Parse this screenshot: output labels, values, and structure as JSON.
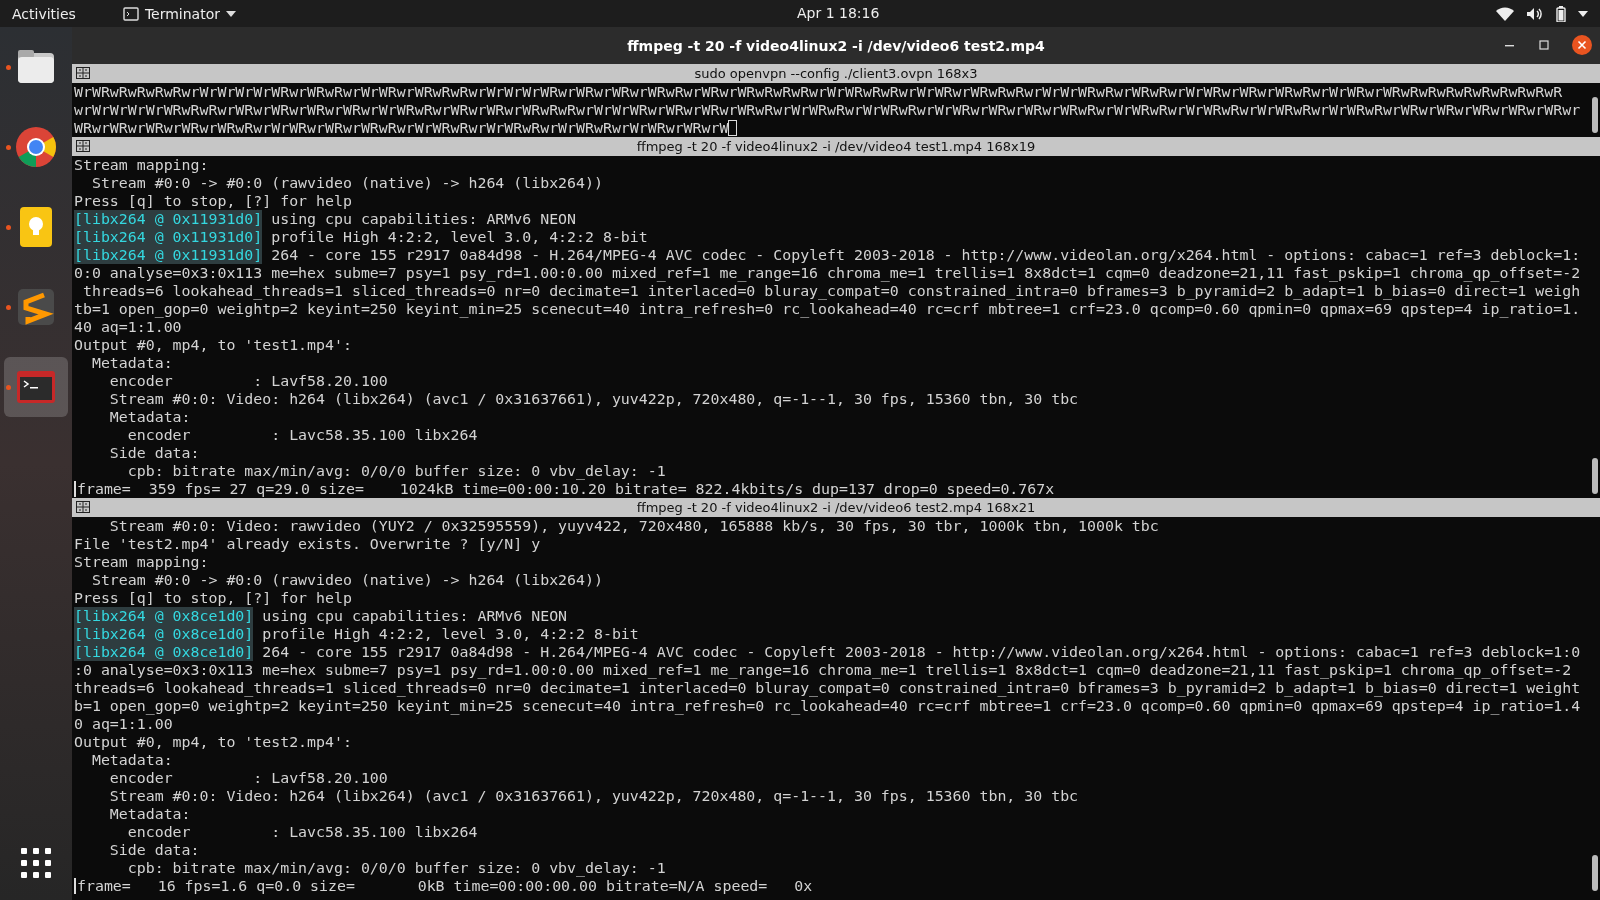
{
  "top_bar": {
    "activities": "Activities",
    "app_name": "Terminator",
    "clock": "Apr 1  18:16"
  },
  "dock": {
    "items": [
      {
        "kind": "files",
        "running": true,
        "selected": false
      },
      {
        "kind": "browser",
        "running": true,
        "selected": false
      },
      {
        "kind": "notes",
        "running": true,
        "selected": false
      },
      {
        "kind": "editor",
        "running": true,
        "selected": false
      },
      {
        "kind": "terminal",
        "running": true,
        "selected": true
      }
    ]
  },
  "window": {
    "title": "ffmpeg -t 20 -f video4linux2 -i /dev/video6 test2.mp4"
  },
  "panes": [
    {
      "title": "sudo openvpn --config ./client3.ovpn 168x3",
      "lines": [
        {
          "text": "WrWRwRwRwRwRwrWrWrWrWrWRwrWRwRwrWrWRwrWRwRwRwrWrWrWrWRwrWRwrWRwrWRwRwrWRwrWRwRwRwRwrWrWRwRwRwrWrWRwrWRwRwRwrWrWrWRwRwrWRwRwrWrWRwrWRwrWRwRwrWrWRwrWRwRwRwRwRwRwRwRwRwR"
        },
        {
          "text": "wrWrWrWrWrWRwRwRwrWRwrWRwrWRwrWRwrWrWRwRwrWRwrWRwrWRwRwRwrWrWrWRwrWRwrWRwrWRwRwrWrWRwRwrWrWRwRwrWrWRwrWRwrWRwrWRwRwrWrWRwRwrWrWRwRwrWrWRwRwrWrWRwRwrWRwrWRwrWRwrWRwrWRwr"
        },
        {
          "text": "WRwrWRwrWRwrWRwrWRwRwrWrWRwrWRwrWRwRwrWrWRwRwrWrWRwRwrWrWRwRwrWrWRwrWRwrW",
          "cursor_after": true
        }
      ]
    },
    {
      "title": "ffmpeg -t 20 -f video4linux2 -i /dev/video4 test1.mp4 168x19",
      "lines": [
        {
          "text": "Stream mapping:"
        },
        {
          "text": "  Stream #0:0 -> #0:0 (rawvideo (native) -> h264 (libx264))"
        },
        {
          "text": "Press [q] to stop, [?] for help"
        },
        {
          "tag": "[libx264 @ 0x11931d0]",
          "text": " using cpu capabilities: ARMv6 NEON"
        },
        {
          "tag": "[libx264 @ 0x11931d0]",
          "text": " profile High 4:2:2, level 3.0, 4:2:2 8-bit"
        },
        {
          "tag": "[libx264 @ 0x11931d0]",
          "text": " 264 - core 155 r2917 0a84d98 - H.264/MPEG-4 AVC codec - Copyleft 2003-2018 - http://www.videolan.org/x264.html - options: cabac=1 ref=3 deblock=1:"
        },
        {
          "text": "0:0 analyse=0x3:0x113 me=hex subme=7 psy=1 psy_rd=1.00:0.00 mixed_ref=1 me_range=16 chroma_me=1 trellis=1 8x8dct=1 cqm=0 deadzone=21,11 fast_pskip=1 chroma_qp_offset=-2"
        },
        {
          "text": " threads=6 lookahead_threads=1 sliced_threads=0 nr=0 decimate=1 interlaced=0 bluray_compat=0 constrained_intra=0 bframes=3 b_pyramid=2 b_adapt=1 b_bias=0 direct=1 weigh"
        },
        {
          "text": "tb=1 open_gop=0 weightp=2 keyint=250 keyint_min=25 scenecut=40 intra_refresh=0 rc_lookahead=40 rc=crf mbtree=1 crf=23.0 qcomp=0.60 qpmin=0 qpmax=69 qpstep=4 ip_ratio=1."
        },
        {
          "text": "40 aq=1:1.00"
        },
        {
          "text": "Output #0, mp4, to 'test1.mp4':"
        },
        {
          "text": "  Metadata:"
        },
        {
          "text": "    encoder         : Lavf58.20.100"
        },
        {
          "text": "    Stream #0:0: Video: h264 (libx264) (avc1 / 0x31637661), yuv422p, 720x480, q=-1--1, 30 fps, 15360 tbn, 30 tbc"
        },
        {
          "text": "    Metadata:"
        },
        {
          "text": "      encoder         : Lavc58.35.100 libx264"
        },
        {
          "text": "    Side data:"
        },
        {
          "text": "      cpb: bitrate max/min/avg: 0/0/0 buffer size: 0 vbv_delay: -1"
        },
        {
          "text": "frame=  359 fps= 27 q=29.0 size=    1024kB time=00:00:10.20 bitrate= 822.4kbits/s dup=137 drop=0 speed=0.767x",
          "cursor_before": true
        }
      ]
    },
    {
      "title": "ffmpeg -t 20 -f video4linux2 -i /dev/video6 test2.mp4 168x21",
      "lines": [
        {
          "text": "    Stream #0:0: Video: rawvideo (YUY2 / 0x32595559), yuyv422, 720x480, 165888 kb/s, 30 fps, 30 tbr, 1000k tbn, 1000k tbc"
        },
        {
          "text": "File 'test2.mp4' already exists. Overwrite ? [y/N] y"
        },
        {
          "text": "Stream mapping:"
        },
        {
          "text": "  Stream #0:0 -> #0:0 (rawvideo (native) -> h264 (libx264))"
        },
        {
          "text": "Press [q] to stop, [?] for help"
        },
        {
          "tag": "[libx264 @ 0x8ce1d0]",
          "text": " using cpu capabilities: ARMv6 NEON"
        },
        {
          "tag": "[libx264 @ 0x8ce1d0]",
          "text": " profile High 4:2:2, level 3.0, 4:2:2 8-bit"
        },
        {
          "tag": "[libx264 @ 0x8ce1d0]",
          "text": " 264 - core 155 r2917 0a84d98 - H.264/MPEG-4 AVC codec - Copyleft 2003-2018 - http://www.videolan.org/x264.html - options: cabac=1 ref=3 deblock=1:0"
        },
        {
          "text": ":0 analyse=0x3:0x113 me=hex subme=7 psy=1 psy_rd=1.00:0.00 mixed_ref=1 me_range=16 chroma_me=1 trellis=1 8x8dct=1 cqm=0 deadzone=21,11 fast_pskip=1 chroma_qp_offset=-2"
        },
        {
          "text": "threads=6 lookahead_threads=1 sliced_threads=0 nr=0 decimate=1 interlaced=0 bluray_compat=0 constrained_intra=0 bframes=3 b_pyramid=2 b_adapt=1 b_bias=0 direct=1 weight"
        },
        {
          "text": "b=1 open_gop=0 weightp=2 keyint=250 keyint_min=25 scenecut=40 intra_refresh=0 rc_lookahead=40 rc=crf mbtree=1 crf=23.0 qcomp=0.60 qpmin=0 qpmax=69 qpstep=4 ip_ratio=1.4"
        },
        {
          "text": "0 aq=1:1.00"
        },
        {
          "text": "Output #0, mp4, to 'test2.mp4':"
        },
        {
          "text": "  Metadata:"
        },
        {
          "text": "    encoder         : Lavf58.20.100"
        },
        {
          "text": "    Stream #0:0: Video: h264 (libx264) (avc1 / 0x31637661), yuv422p, 720x480, q=-1--1, 30 fps, 15360 tbn, 30 tbc"
        },
        {
          "text": "    Metadata:"
        },
        {
          "text": "      encoder         : Lavc58.35.100 libx264"
        },
        {
          "text": "    Side data:"
        },
        {
          "text": "      cpb: bitrate max/min/avg: 0/0/0 buffer size: 0 vbv_delay: -1"
        },
        {
          "text": "frame=   16 fps=1.6 q=0.0 size=       0kB time=00:00:00.00 bitrate=N/A speed=   0x",
          "cursor_before": true
        }
      ]
    }
  ]
}
